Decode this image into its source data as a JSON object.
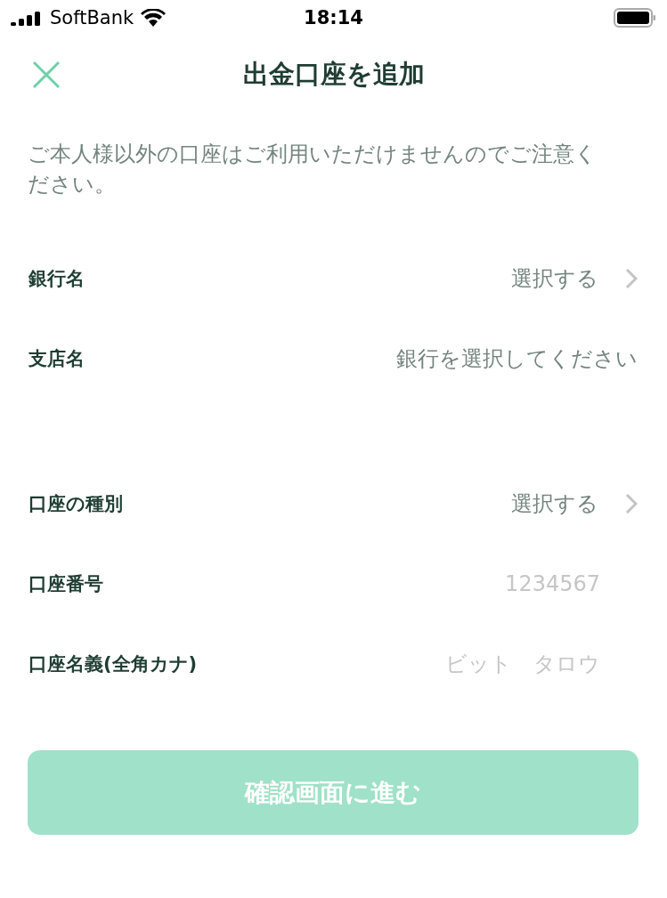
{
  "status_bar": {
    "carrier": "SoftBank",
    "time": "18:14"
  },
  "header": {
    "title": "出金口座を追加"
  },
  "notice": "ご本人様以外の口座はご利用いただけませんのでご注意ください。",
  "fields": [
    {
      "kind": "select",
      "label": "銀行名",
      "value": "選択する"
    },
    {
      "kind": "info",
      "label": "支店名",
      "value": "銀行を選択してください"
    },
    {
      "kind": "gap"
    },
    {
      "kind": "select",
      "label": "口座の種別",
      "value": "選択する"
    },
    {
      "kind": "input",
      "label": "口座番号",
      "placeholder": "1234567"
    },
    {
      "kind": "input",
      "label": "口座名義(全角カナ)",
      "placeholder": "ビット　タロウ"
    }
  ],
  "submit": {
    "label": "確認画面に進む",
    "disabled": true
  }
}
